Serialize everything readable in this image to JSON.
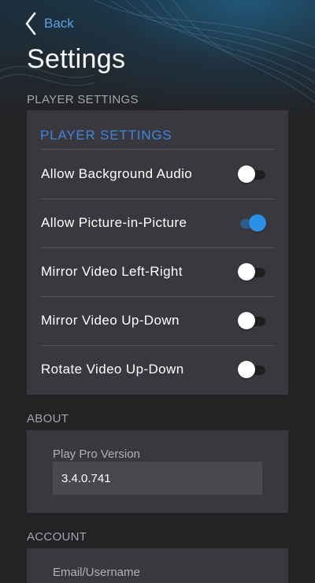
{
  "nav": {
    "back_label": "Back",
    "title": "Settings"
  },
  "player_section": {
    "header": "PLAYER SETTINGS",
    "card_title": "PLAYER SETTINGS",
    "settings": [
      {
        "label": "Allow Background Audio",
        "enabled": false
      },
      {
        "label": "Allow Picture-in-Picture",
        "enabled": true
      },
      {
        "label": "Mirror Video Left-Right",
        "enabled": false
      },
      {
        "label": "Mirror Video Up-Down",
        "enabled": false
      },
      {
        "label": "Rotate Video Up-Down",
        "enabled": false
      }
    ]
  },
  "about_section": {
    "header": "ABOUT",
    "version_label": "Play Pro Version",
    "version_value": "3.4.0.741"
  },
  "account_section": {
    "header": "ACCOUNT",
    "email_label": "Email/Username"
  },
  "colors": {
    "accent": "#3c86e6",
    "back_link": "#5aa0e6",
    "background": "#232326",
    "card": "#38383d",
    "toggle_on": "#2a8fe6"
  },
  "icons": {
    "back": "chevron-left-icon"
  }
}
